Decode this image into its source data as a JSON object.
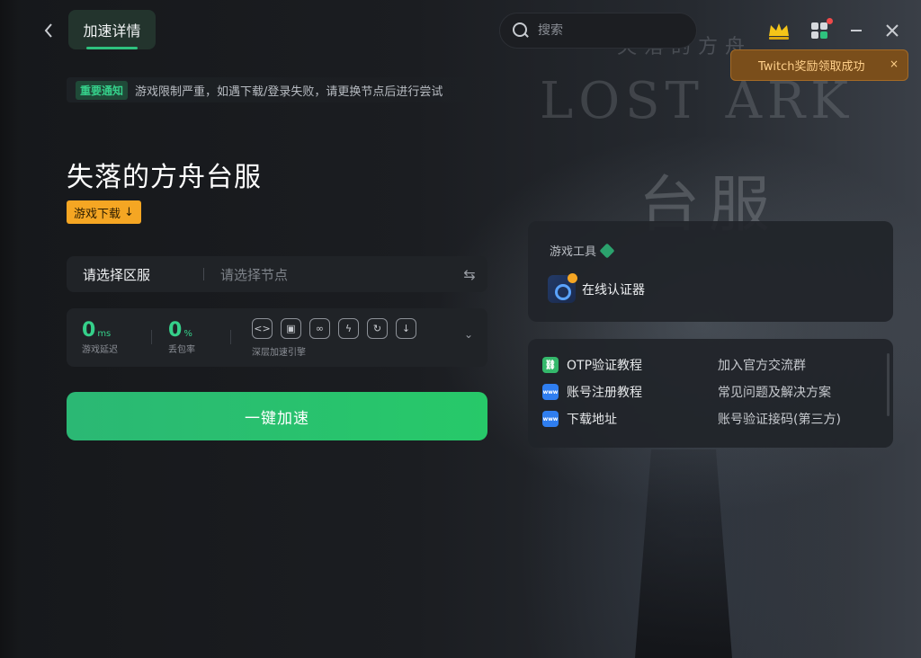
{
  "header": {
    "tab_label": "加速详情",
    "search_placeholder": "搜索"
  },
  "toast": {
    "message": "Twitch奖励领取成功",
    "close": "×"
  },
  "background": {
    "art_line1": "失落的方舟",
    "art_line2": "LOST ARK",
    "art_line3": "台服"
  },
  "notice": {
    "tag": "重要通知",
    "text": "游戏限制严重，如遇下载/登录失败，请更换节点后进行尝试"
  },
  "game": {
    "title": "失落的方舟台服",
    "download_label": "游戏下载",
    "download_icon": "↓"
  },
  "selector": {
    "region_placeholder": "请选择区服",
    "node_placeholder": "请选择节点",
    "swap_icon": "⇆"
  },
  "stats": {
    "latency_value": "0",
    "latency_unit": "ms",
    "latency_label": "游戏延迟",
    "loss_value": "0",
    "loss_unit": "%",
    "loss_label": "丢包率",
    "engine_label": "深层加速引擎",
    "engine_icons": [
      "<>",
      "▣",
      "∞",
      "ϟ",
      "↻",
      "↓"
    ],
    "expand_icon": "⌄"
  },
  "accelerate": {
    "label": "一键加速"
  },
  "tools": {
    "title": "游戏工具",
    "items": [
      {
        "label": "在线认证器"
      }
    ]
  },
  "links": {
    "left": [
      {
        "label": "OTP验证教程",
        "icon": "link-icon",
        "color": "#34b86b",
        "glyph": "⛓"
      },
      {
        "label": "账号注册教程",
        "icon": "browser-icon",
        "color": "#2f7ef0",
        "glyph": "www"
      },
      {
        "label": "下载地址",
        "icon": "browser-icon",
        "color": "#2f7ef0",
        "glyph": "www"
      }
    ],
    "right": [
      {
        "label": "加入官方交流群"
      },
      {
        "label": "常见问题及解决方案"
      },
      {
        "label": "账号验证接码(第三方)"
      }
    ]
  },
  "colors": {
    "accent_green": "#2ec27e",
    "warning_orange": "#f5a623",
    "toast_bg": "#7a4e1b"
  }
}
